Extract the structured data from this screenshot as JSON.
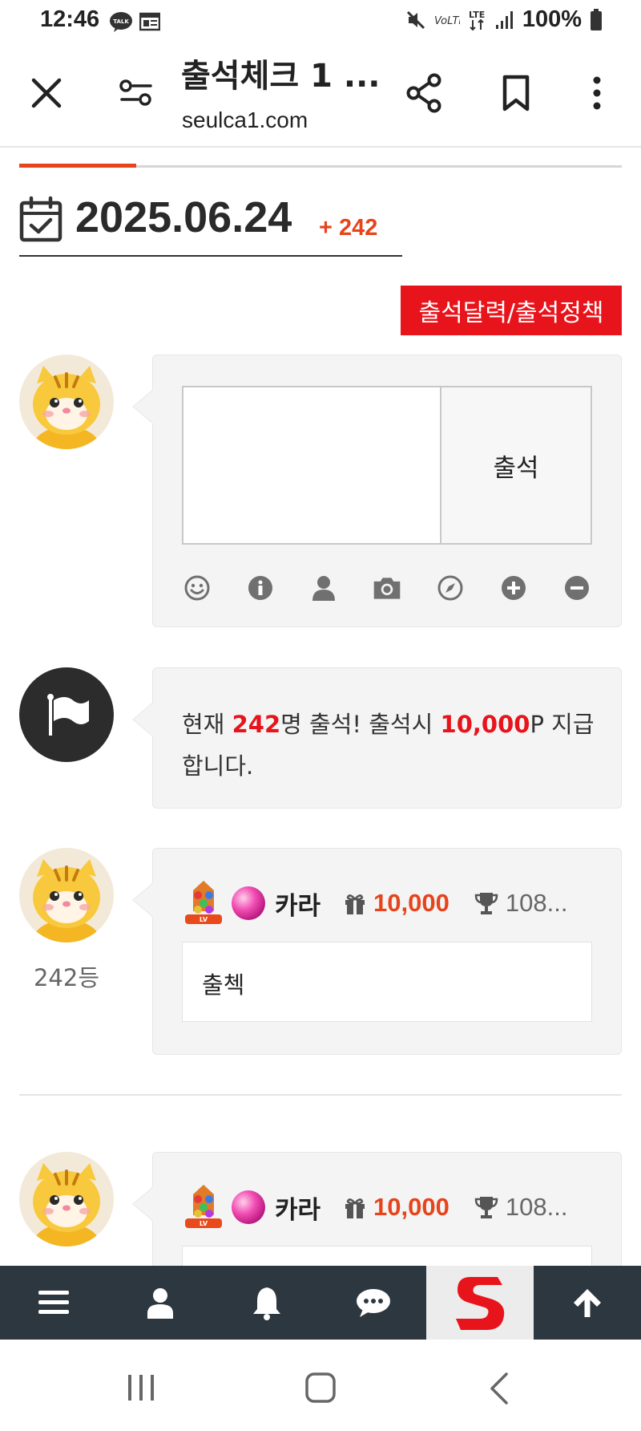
{
  "status_bar": {
    "time": "12:46",
    "battery": "100%",
    "icons": [
      "kakaotalk-icon",
      "news-icon",
      "mute-icon",
      "volte-icon",
      "lte-icon",
      "signal-icon",
      "battery-icon"
    ]
  },
  "browser": {
    "title": "출석체크 1 ...",
    "url": "seulca1.com",
    "icons": [
      "close-icon",
      "filter-icon",
      "share-icon",
      "bookmark-icon",
      "more-icon"
    ]
  },
  "date_header": {
    "date": "2025.06.24",
    "count": "+ 242"
  },
  "policy_button": "출석달력/출석정책",
  "comment_form": {
    "placeholder": "",
    "submit_label": "출석",
    "tools": [
      "smile-icon",
      "info-icon",
      "user-icon",
      "camera-icon",
      "compass-icon",
      "plus-circle-icon",
      "minus-circle-icon"
    ]
  },
  "notice": {
    "prefix": "현재 ",
    "count": "242",
    "middle": "명 출석! 출석시 ",
    "points": "10,000",
    "suffix": "P 지급합니다."
  },
  "entries": [
    {
      "rank": "242등",
      "nickname": "카라",
      "points": "10,000",
      "trophy": "108...",
      "comment": "출첵"
    },
    {
      "rank": "",
      "nickname": "카라",
      "points": "10,000",
      "trophy": "108...",
      "comment": ""
    }
  ],
  "colors": {
    "accent": "#e5441c",
    "red": "#e8141c",
    "toolbar_bg": "#2d3740",
    "bubble_bg": "#f4f4f4"
  },
  "site_toolbar": [
    "menu-icon",
    "user-icon",
    "bell-icon",
    "chat-icon",
    "site-logo",
    "arrow-up-icon"
  ]
}
